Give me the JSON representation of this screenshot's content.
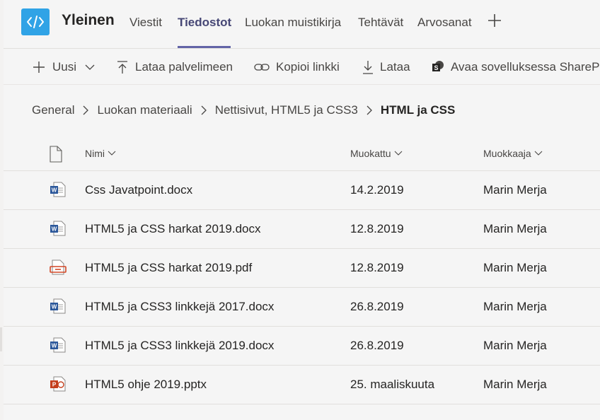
{
  "header": {
    "channel_name": "Yleinen",
    "tabs": [
      {
        "label": "Viestit",
        "active": false
      },
      {
        "label": "Tiedostot",
        "active": true
      },
      {
        "label": "Luokan muistikirja",
        "active": false
      },
      {
        "label": "Tehtävät",
        "active": false
      },
      {
        "label": "Arvosanat",
        "active": false
      }
    ]
  },
  "toolbar": {
    "new_label": "Uusi",
    "upload_label": "Lataa palvelimeen",
    "copy_link_label": "Kopioi linkki",
    "download_label": "Lataa",
    "sharepoint_label": "Avaa sovelluksessa SharePo"
  },
  "breadcrumb": {
    "items": [
      "General",
      "Luokan materiaali",
      "Nettisivut, HTML5 ja CSS3"
    ],
    "current": "HTML ja CSS"
  },
  "table": {
    "columns": {
      "name": "Nimi",
      "modified": "Muokattu",
      "modified_by": "Muokkaaja"
    },
    "rows": [
      {
        "type": "word-icon",
        "name": "Css Javatpoint.docx",
        "modified": "14.2.2019",
        "modified_by": "Marin Merja"
      },
      {
        "type": "word-icon",
        "name": "HTML5 ja CSS harkat 2019.docx",
        "modified": "12.8.2019",
        "modified_by": "Marin Merja"
      },
      {
        "type": "pdf-icon",
        "name": "HTML5 ja CSS harkat 2019.pdf",
        "modified": "12.8.2019",
        "modified_by": "Marin Merja"
      },
      {
        "type": "word-icon",
        "name": "HTML5 ja CSS3 linkkejä 2017.docx",
        "modified": "26.8.2019",
        "modified_by": "Marin Merja"
      },
      {
        "type": "word-icon",
        "name": "HTML5 ja CSS3 linkkejä 2019.docx",
        "modified": "26.8.2019",
        "modified_by": "Marin Merja"
      },
      {
        "type": "powerpoint-icon",
        "name": "HTML5 ohje 2019.pptx",
        "modified": "25. maaliskuuta",
        "modified_by": "Marin Merja"
      }
    ]
  },
  "colors": {
    "accent": "#6264a7",
    "app_tile": "#30a3e6",
    "word": "#2b579a",
    "pdf": "#d24726",
    "powerpoint": "#c43e1c"
  }
}
